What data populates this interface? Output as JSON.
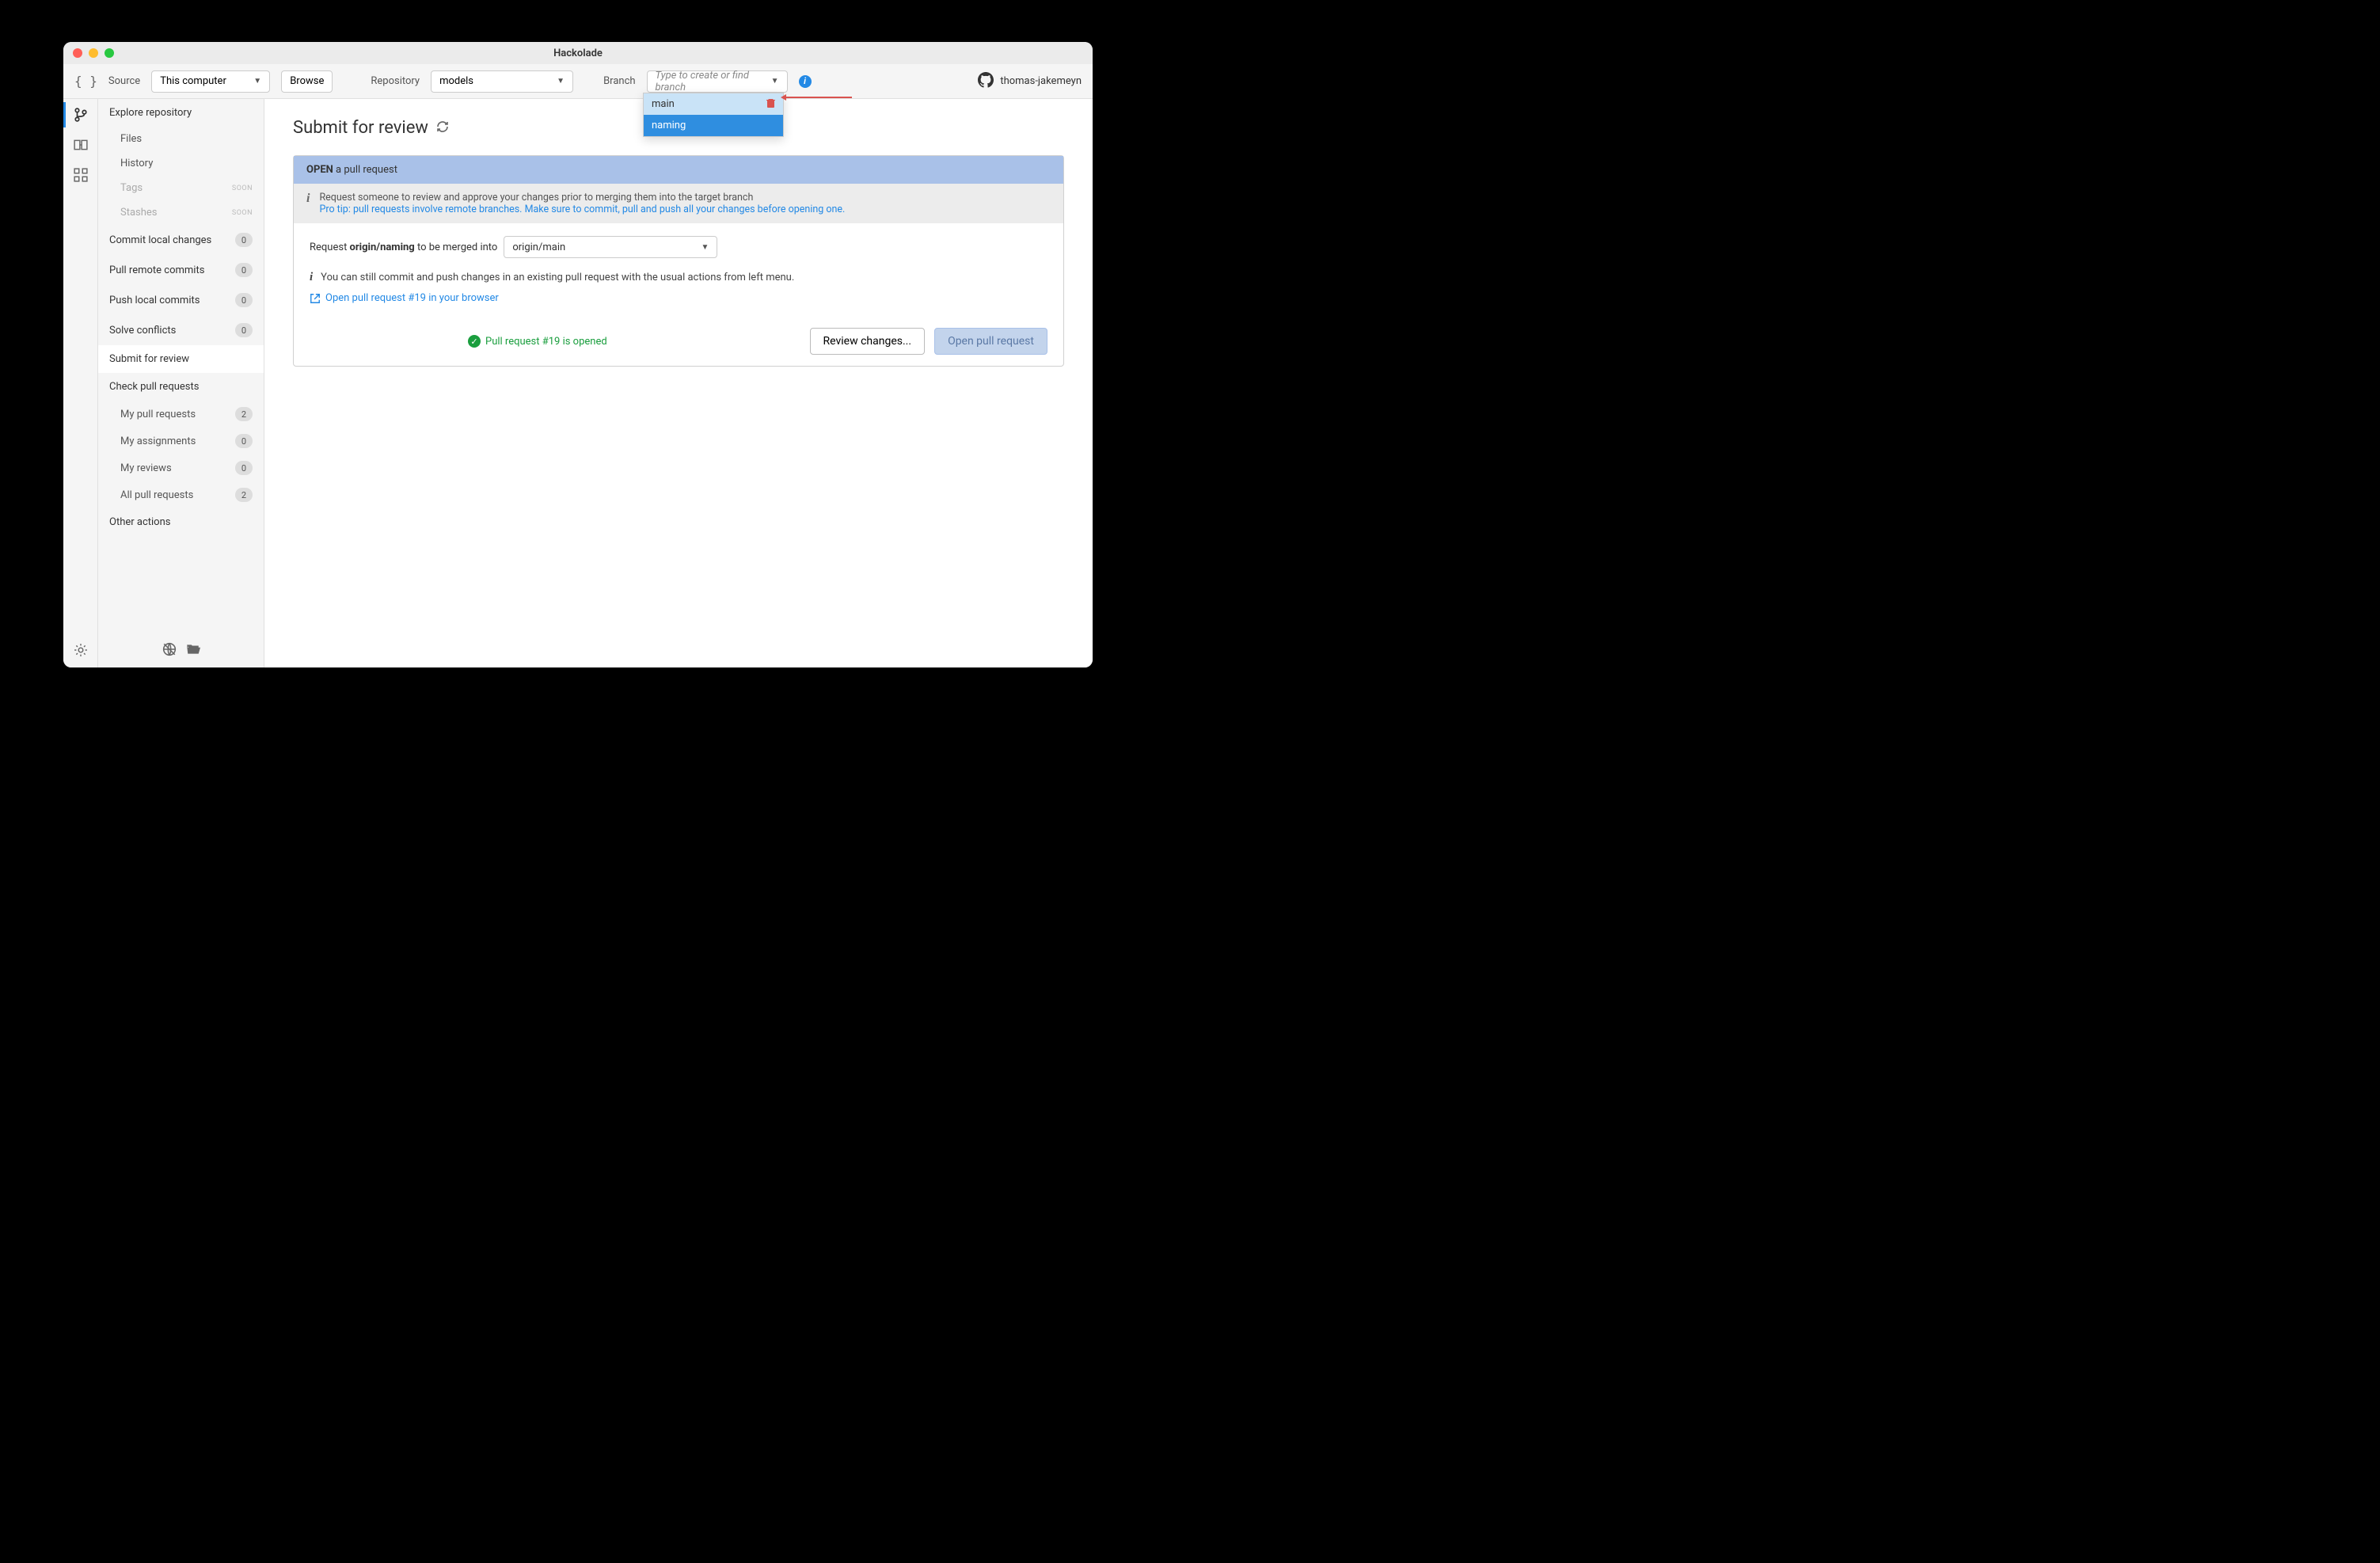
{
  "window": {
    "title": "Hackolade"
  },
  "toolbar": {
    "source_label": "Source",
    "source_value": "This computer",
    "browse_label": "Browse",
    "repo_label": "Repository",
    "repo_value": "models",
    "branch_label": "Branch",
    "branch_placeholder": "Type to create or find branch",
    "user": "thomas-jakemeyn"
  },
  "branch_dropdown": {
    "items": [
      {
        "label": "main",
        "deletable": true
      },
      {
        "label": "naming",
        "selected": true
      }
    ]
  },
  "sidebar": {
    "explore": {
      "label": "Explore repository"
    },
    "files": {
      "label": "Files"
    },
    "history": {
      "label": "History"
    },
    "tags": {
      "label": "Tags",
      "soon": "SOON"
    },
    "stashes": {
      "label": "Stashes",
      "soon": "SOON"
    },
    "commit": {
      "label": "Commit local changes",
      "count": "0"
    },
    "pull": {
      "label": "Pull remote commits",
      "count": "0"
    },
    "push": {
      "label": "Push local commits",
      "count": "0"
    },
    "solve": {
      "label": "Solve conflicts",
      "count": "0"
    },
    "submit": {
      "label": "Submit for review"
    },
    "check": {
      "label": "Check pull requests"
    },
    "my_prs": {
      "label": "My pull requests",
      "count": "2"
    },
    "my_assign": {
      "label": "My assignments",
      "count": "0"
    },
    "my_reviews": {
      "label": "My reviews",
      "count": "0"
    },
    "all_prs": {
      "label": "All pull requests",
      "count": "2"
    },
    "other": {
      "label": "Other actions"
    }
  },
  "main": {
    "title": "Submit for review",
    "panel_head_bold": "OPEN",
    "panel_head_rest": " a pull request",
    "info_line1": "Request someone to review and approve your changes prior to merging them into the target branch",
    "info_pro": "Pro tip: pull requests involve remote branches. Make sure to commit, pull and push all your changes before opening one.",
    "merge_prefix": "Request ",
    "merge_branch": "origin/naming",
    "merge_suffix": " to be merged into",
    "merge_target": "origin/main",
    "note": "You can still commit and push changes in an existing pull request with the usual actions from left menu.",
    "open_link": "Open pull request #19 in your browser",
    "status": "Pull request #19 is opened",
    "review_btn": "Review changes...",
    "open_btn": "Open pull request"
  }
}
